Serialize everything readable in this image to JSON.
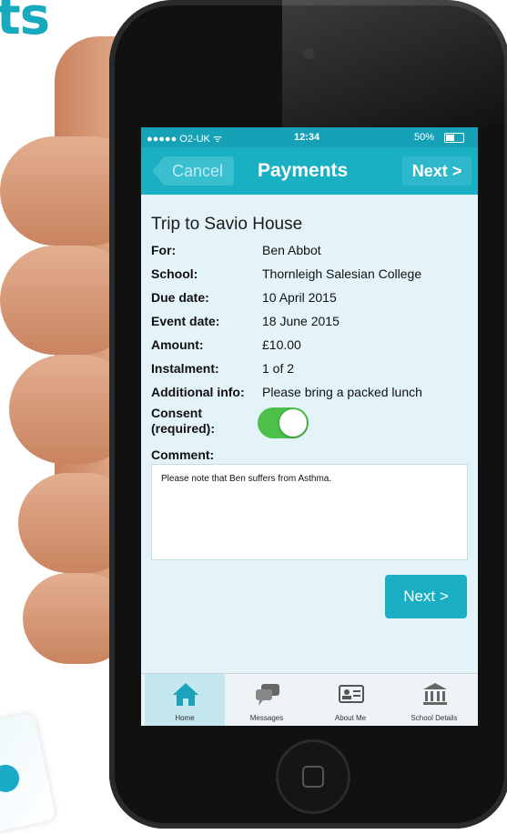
{
  "brand_fragment": "ts",
  "status_bar": {
    "carrier": "●●●●● O2-UK ᯤ",
    "time": "12:34",
    "battery": "50%"
  },
  "nav": {
    "cancel_label": "Cancel",
    "title": "Payments",
    "next_label": "Next >"
  },
  "payment": {
    "trip_title": "Trip to Savio House",
    "details": [
      {
        "label": "For:",
        "value": "Ben Abbot"
      },
      {
        "label": "School:",
        "value": "Thornleigh Salesian College"
      },
      {
        "label": "Due date:",
        "value": "10 April 2015"
      },
      {
        "label": "Event date:",
        "value": "18 June 2015"
      },
      {
        "label": "Amount:",
        "value": "£10.00"
      },
      {
        "label": "Instalment:",
        "value": "1 of 2"
      },
      {
        "label": "Additional info:",
        "value": "Please bring a packed lunch"
      }
    ],
    "consent_label": "Consent (required):",
    "consent_on": true,
    "comment_label": "Comment:",
    "comment_text": "Please note that Ben suffers from Asthma.",
    "next_button_label": "Next >"
  },
  "tab_bar": {
    "tabs": [
      {
        "label": "Home",
        "icon": "home-icon",
        "active": true
      },
      {
        "label": "Messages",
        "icon": "messages-icon",
        "active": false
      },
      {
        "label": "About Me",
        "icon": "id-card-icon",
        "active": false
      },
      {
        "label": "School Details",
        "icon": "school-building-icon",
        "active": false
      }
    ]
  },
  "colors": {
    "accent": "#1ab0c4",
    "toggle_on": "#4cc04a",
    "screen_bg": "#e4f3f7"
  }
}
